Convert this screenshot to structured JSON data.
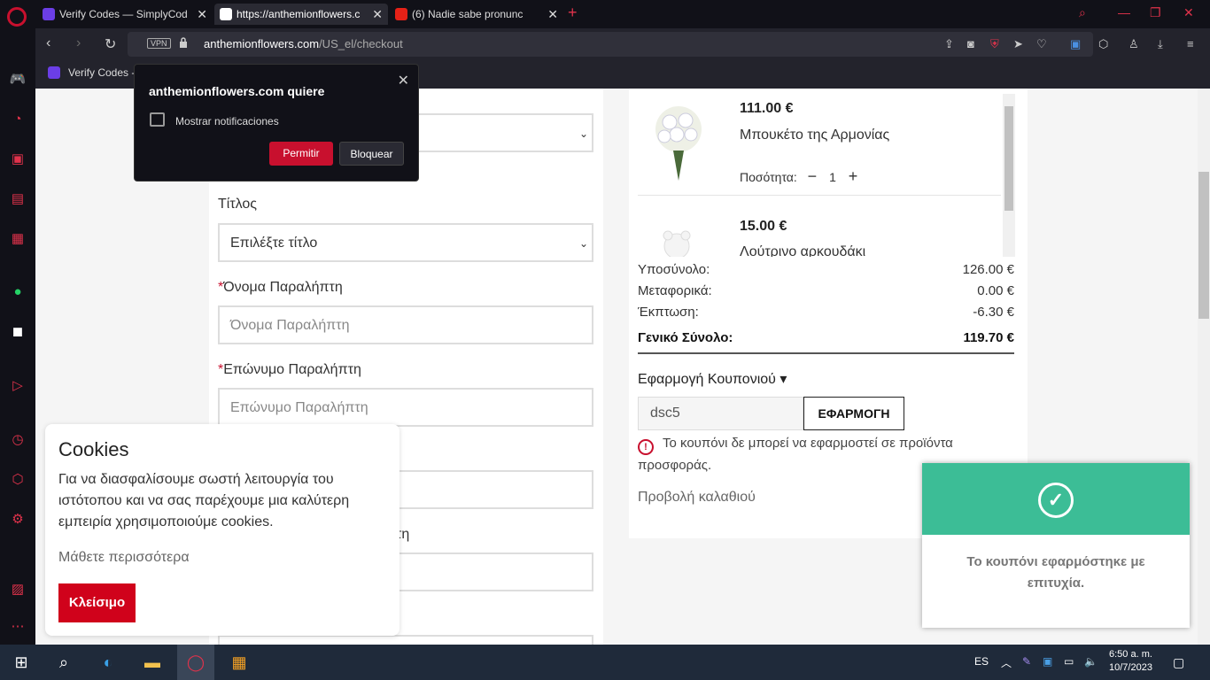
{
  "browser": {
    "tabs": [
      {
        "label": "Verify Codes — SimplyCod",
        "color": "#6b3ee6"
      },
      {
        "label": "https://anthemionflowers.c",
        "color": "#ffffff"
      },
      {
        "label": "(6) Nadie sabe pronunc",
        "color": "#e62117"
      }
    ],
    "url_vpn": "VPN",
    "url_host": "anthemionflowers.com",
    "url_path": "/US_el/checkout",
    "bookmark": "Verify Codes -"
  },
  "notification": {
    "title": "anthemionflowers.com quiere",
    "text": "Mostrar notificaciones",
    "allow": "Permitir",
    "block": "Bloquear"
  },
  "form": {
    "title_label": "Τίτλος",
    "title_select": "Επιλέξτε τίτλο",
    "first_name_label": "Όνομα Παραλήπτη",
    "first_name_placeholder": "Όνομα Παραλήπτη",
    "last_name_label": "Επώνυμο Παραλήπτη",
    "last_name_placeholder": "Επώνυμο Παραλήπτη",
    "partial_label": "τη"
  },
  "cart": {
    "items": [
      {
        "price": "111.00 €",
        "name": "Μπουκέτο της Αρμονίας",
        "qty_label": "Ποσότητα:",
        "qty": "1"
      },
      {
        "price": "15.00 €",
        "name": "Λούτρινο αρκουδάκι"
      }
    ],
    "subtotal_label": "Υποσύνολο:",
    "subtotal": "126.00 €",
    "shipping_label": "Μεταφορικά:",
    "shipping": "0.00 €",
    "discount_label": "Έκπτωση:",
    "discount": "-6.30 €",
    "total_label": "Γενικό Σύνολο:",
    "total": "119.70 €",
    "coupon_toggle": "Εφαρμογή Κουπονιού",
    "coupon_value": "dsc5",
    "coupon_button": "ΕΦΑΡΜΟΓΗ",
    "coupon_error": "Το κουπόνι δε μπορεί να εφαρμοστεί σε προϊόντα προσφοράς.",
    "view_cart": "Προβολή καλαθιού"
  },
  "cookies": {
    "title": "Cookies",
    "text": "Για να διασφαλίσουμε σωστή λειτουργία του ιστότοπου και να σας παρέχουμε μια καλύτερη εμπειρία χρησιμοποιούμε cookies.",
    "more": "Μάθετε περισσότερα",
    "close": "Κλείσιμο"
  },
  "toast": {
    "message": "Το κουπόνι εφαρμόστηκε με επιτυχία."
  },
  "taskbar": {
    "lang": "ES",
    "time": "6:50 a. m.",
    "date": "10/7/2023"
  }
}
